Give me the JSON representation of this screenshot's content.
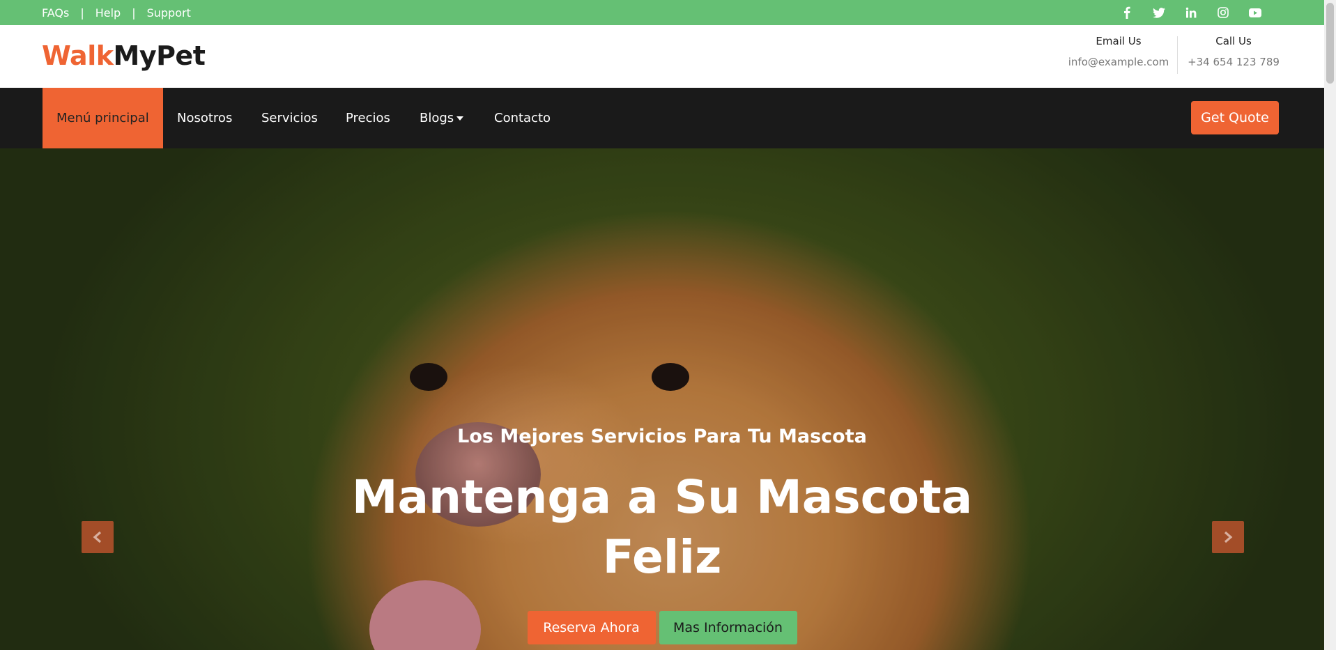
{
  "topbar": {
    "links": [
      "FAQs",
      "Help",
      "Support"
    ],
    "separator": "|",
    "social_icons": [
      "facebook-icon",
      "twitter-icon",
      "linkedin-icon",
      "instagram-icon",
      "youtube-icon"
    ],
    "color": "#65c074"
  },
  "header": {
    "logo_part1": "Walk",
    "logo_part2": "MyPet",
    "email_title": "Email Us",
    "email_value": "info@example.com",
    "phone_title": "Call Us",
    "phone_value": "+34 654 123 789"
  },
  "nav": {
    "items": [
      "Menú principal",
      "Nosotros",
      "Servicios",
      "Precios",
      "Blogs",
      "Contacto"
    ],
    "active_index": 0,
    "quote_label": "Get Quote",
    "accent": "#ef6433"
  },
  "hero": {
    "subtitle": "Los Mejores Servicios Para Tu Mascota",
    "title_line1": "Mantenga a Su Mascota",
    "title_line2": "Feliz",
    "primary_button": "Reserva Ahora",
    "secondary_button": "Mas Información",
    "prev_icon": "chevron-left-icon",
    "next_icon": "chevron-right-icon"
  }
}
